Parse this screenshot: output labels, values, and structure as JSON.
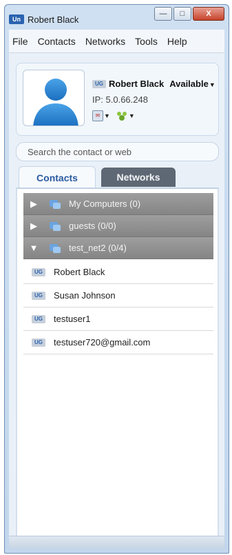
{
  "window": {
    "title": "Robert Black",
    "logo_text": "Un",
    "minimize_glyph": "—",
    "maximize_glyph": "□",
    "close_glyph": "X"
  },
  "menu": [
    "File",
    "Contacts",
    "Networks",
    "Tools",
    "Help"
  ],
  "profile": {
    "badge": "UG",
    "name": "Robert Black",
    "status": "Available",
    "ip": "IP: 5.0.66.248"
  },
  "search": {
    "placeholder": "Search the contact or web"
  },
  "tabs": [
    {
      "label": "Contacts",
      "active": true
    },
    {
      "label": "Networks",
      "active": false
    }
  ],
  "groups": [
    {
      "label": "My Computers (0)",
      "expanded": false,
      "arrow": "▶"
    },
    {
      "label": "guests (0/0)",
      "expanded": false,
      "arrow": "▶"
    },
    {
      "label": "test_net2 (0/4)",
      "expanded": true,
      "arrow": "▼"
    }
  ],
  "contacts": [
    {
      "badge": "UG",
      "name": "Robert Black"
    },
    {
      "badge": "UG",
      "name": "Susan Johnson"
    },
    {
      "badge": "UG",
      "name": "testuser1"
    },
    {
      "badge": "UG",
      "name": "testuser720@gmail.com"
    }
  ],
  "colors": {
    "accent": "#2a5aa0",
    "group_bg": "#8f8f8f",
    "inactive_tab": "#5e6874",
    "close_button": "#c5432b"
  },
  "icons": {
    "app_logo": "unreal-logo-icon",
    "avatar": "user-silhouette-icon",
    "user_badge": "ug-user-badge-icon",
    "network_group": "network-group-icon",
    "tool_1": "messaging-tool-icon",
    "tool_2": "buddies-tool-icon"
  }
}
